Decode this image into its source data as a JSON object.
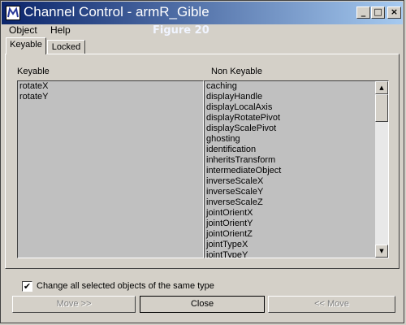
{
  "window": {
    "title": "Channel Control - armR_Gible",
    "controls": {
      "minimize": "_",
      "maximize": "□",
      "close": "×"
    }
  },
  "menu": {
    "items": [
      "Object",
      "Help"
    ]
  },
  "overlay_label": "Figure 20",
  "tabs": [
    {
      "label": "Keyable",
      "active": true
    },
    {
      "label": "Locked",
      "active": false
    }
  ],
  "columns": {
    "keyable_header": "Keyable",
    "non_keyable_header": "Non Keyable"
  },
  "keyable_items": [
    "rotateX",
    "rotateY"
  ],
  "non_keyable_items": [
    "caching",
    "displayHandle",
    "displayLocalAxis",
    "displayRotatePivot",
    "displayScalePivot",
    "ghosting",
    "identification",
    "inheritsTransform",
    "intermediateObject",
    "inverseScaleX",
    "inverseScaleY",
    "inverseScaleZ",
    "jointOrientX",
    "jointOrientY",
    "jointOrientZ",
    "jointTypeX",
    "jointTypeY"
  ],
  "checkbox": {
    "label": "Change all selected objects of the same type",
    "checked": true
  },
  "buttons": {
    "move_right": "Move >>",
    "close": "Close",
    "move_left": "<< Move"
  },
  "icons": {
    "app": "channel-control-app-icon",
    "scroll_up": "scroll-up-arrow-icon",
    "scroll_down": "scroll-down-arrow-icon"
  }
}
